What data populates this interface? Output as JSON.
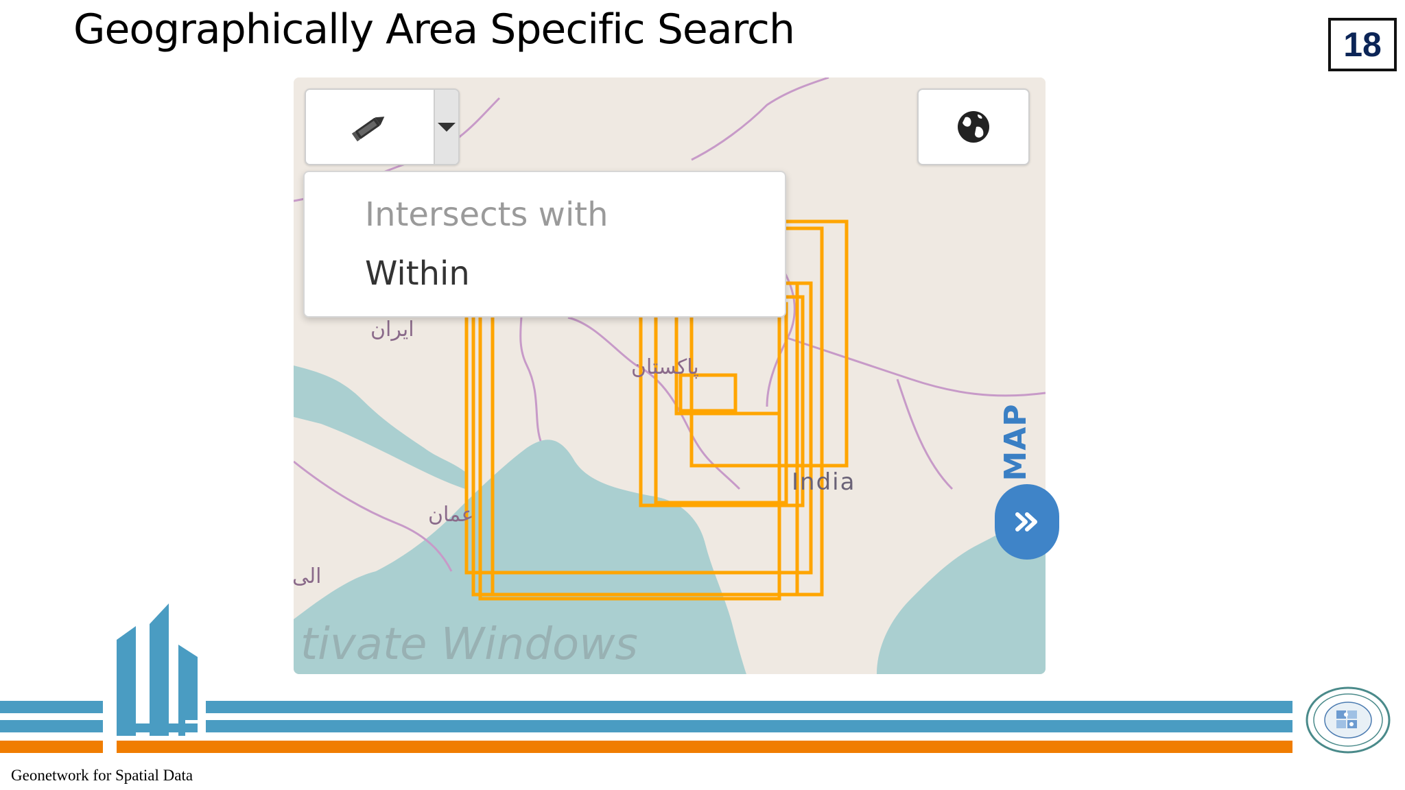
{
  "slide": {
    "title": "Geographically Area Specific Search",
    "page_number": "18",
    "footer": "Geonetwork for Spatial Data"
  },
  "map_widget": {
    "draw_tool": {
      "icon": "pencil-icon"
    },
    "dropdown_toggle": {
      "icon": "caret-down-icon"
    },
    "globe_button": {
      "icon": "globe-icon"
    },
    "spatial_relation_menu": {
      "items": [
        "Intersects with",
        "Within"
      ]
    },
    "side_tab_label": "MAP",
    "expand_button": {
      "icon": "double-chevron-right-icon"
    },
    "map_labels": {
      "india": "India",
      "iran": "ایران",
      "pakistan": "پاکستان",
      "oman": "عمان",
      "yemen": "الی"
    },
    "watermark": "tivate Windows",
    "colors": {
      "bbox_stroke": "#ffa500",
      "water": "#aacfd0",
      "land": "#efe9e2",
      "border": "#c79ac8",
      "tab_blue": "#3f84c8"
    }
  },
  "branding": {
    "colors": {
      "stripe_blue": "#4a9cc2",
      "stripe_orange": "#f07d00"
    }
  }
}
